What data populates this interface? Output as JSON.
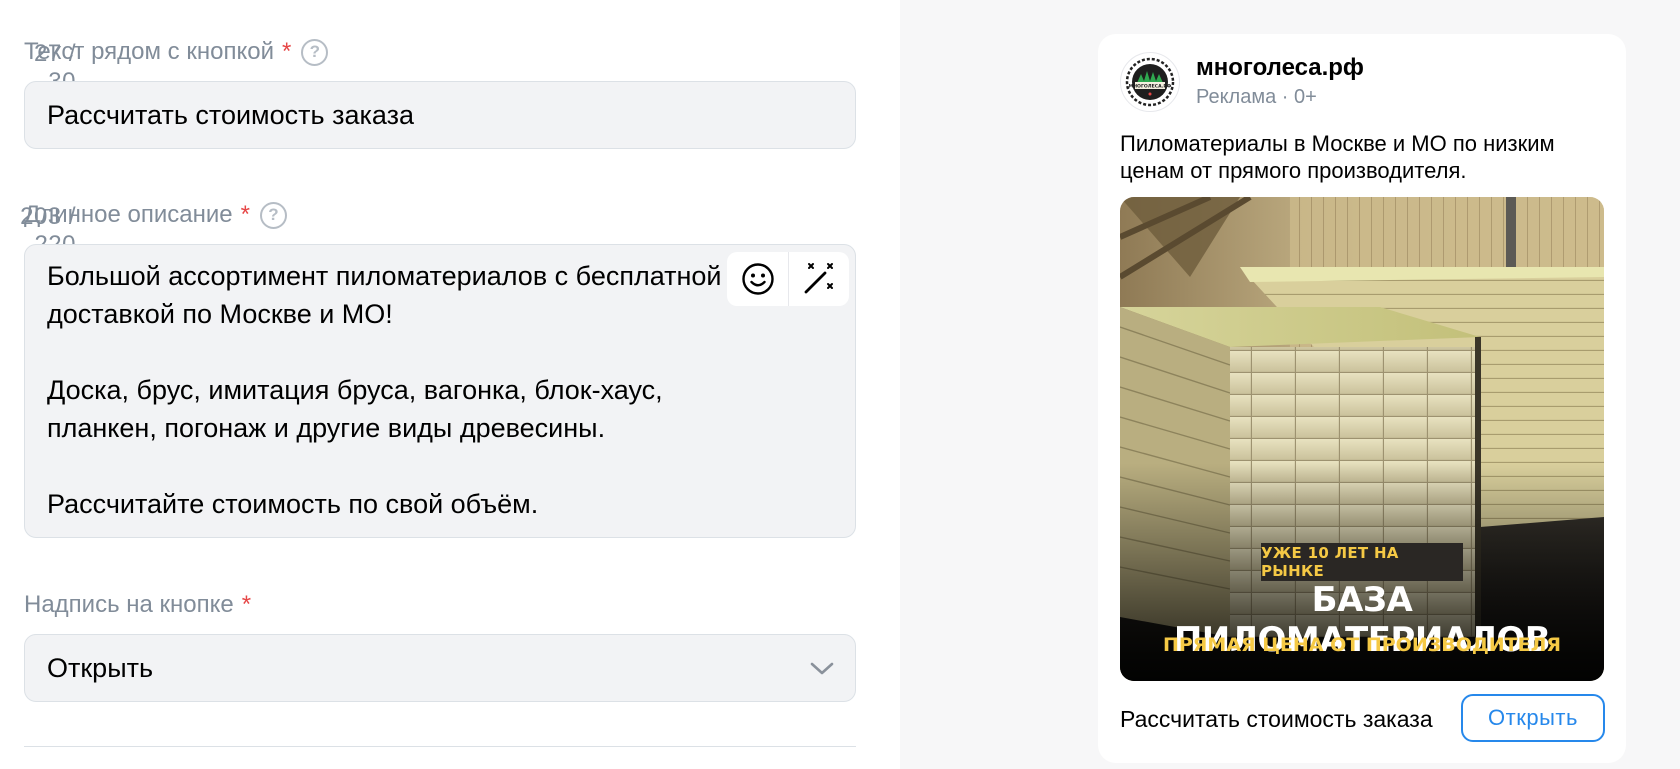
{
  "form": {
    "button_text_field": {
      "label": "Текст рядом с кнопкой",
      "required_mark": "*",
      "counter": "27 / 30",
      "value": "Рассчитать стоимость заказа"
    },
    "long_description_field": {
      "label": "Длинное описание",
      "required_mark": "*",
      "counter": "203 / 220",
      "value": "Большой ассортимент пиломатериалов с бесплатной доставкой по Москве и МО!\n\nДоска, брус, имитация бруса, вагонка, блок-хаус, планкен, погонаж и другие виды древесины.\n\nРассчитайте стоимость по свой объём.",
      "tools": [
        "emoji-icon",
        "magic-wand-icon"
      ]
    },
    "button_caption_field": {
      "label": "Надпись на кнопке",
      "required_mark": "*",
      "selected": "Открыть"
    }
  },
  "preview": {
    "brand_name": "многолеса.рф",
    "ad_meta": "Реклама · 0+",
    "ad_text": "Пиломатериалы в Москве и МО по низким ценам от прямого производителя.",
    "logo_text": "МНОГОЛЕСА.РФ",
    "banner": {
      "badge": "УЖЕ 10 ЛЕТ НА РЫНКЕ",
      "title": "БАЗА ПИЛОМАТЕРИАЛОВ",
      "subtitle": "ПРЯМАЯ ЦЕНА ОТ ПРОИЗВОДИТЕЛЯ"
    },
    "caption": "Рассчитать стоимость заказа",
    "button_label": "Открыть"
  },
  "colors": {
    "accent": "#2688eb",
    "required": "#e64646",
    "muted_text": "#818c99",
    "field_bg": "#f2f3f5",
    "banner_yellow": "#f5c945"
  }
}
